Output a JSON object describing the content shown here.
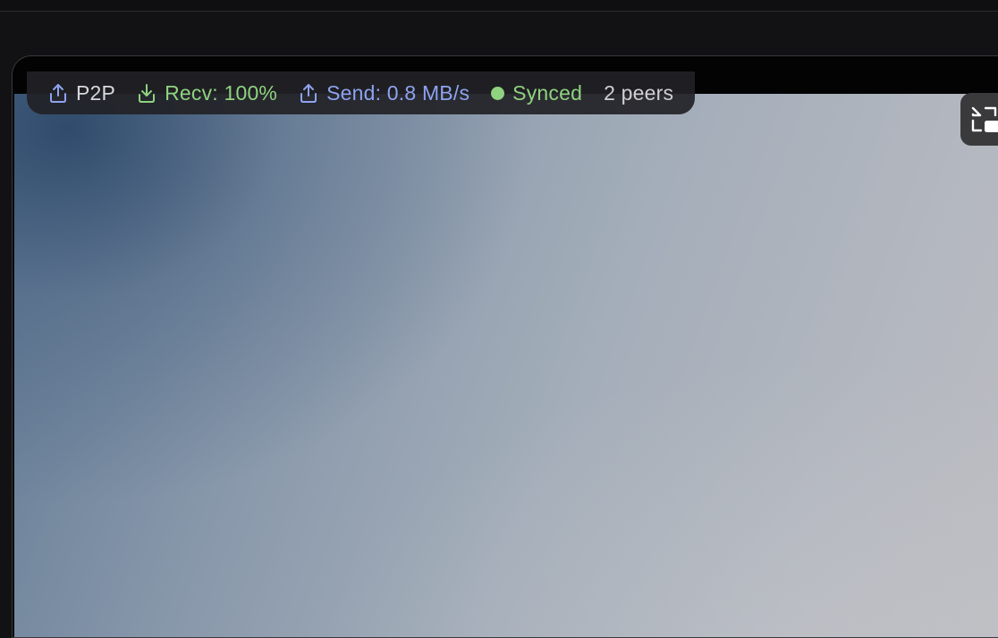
{
  "status_bar": {
    "p2p_label": "P2P",
    "p2p_icon": "upload-icon",
    "recv_label": "Recv: 100%",
    "recv_icon": "download-icon",
    "send_label": "Send: 0.8 MB/s",
    "send_icon": "upload-icon",
    "sync_label": "Synced",
    "peers_label": "2 peers"
  },
  "controls": {
    "pip_icon": "picture-in-picture-icon"
  },
  "colors": {
    "recv": "#8fd27f",
    "send": "#8ea3f0",
    "synced": "#8fd27f",
    "pill_background": "#222226"
  }
}
